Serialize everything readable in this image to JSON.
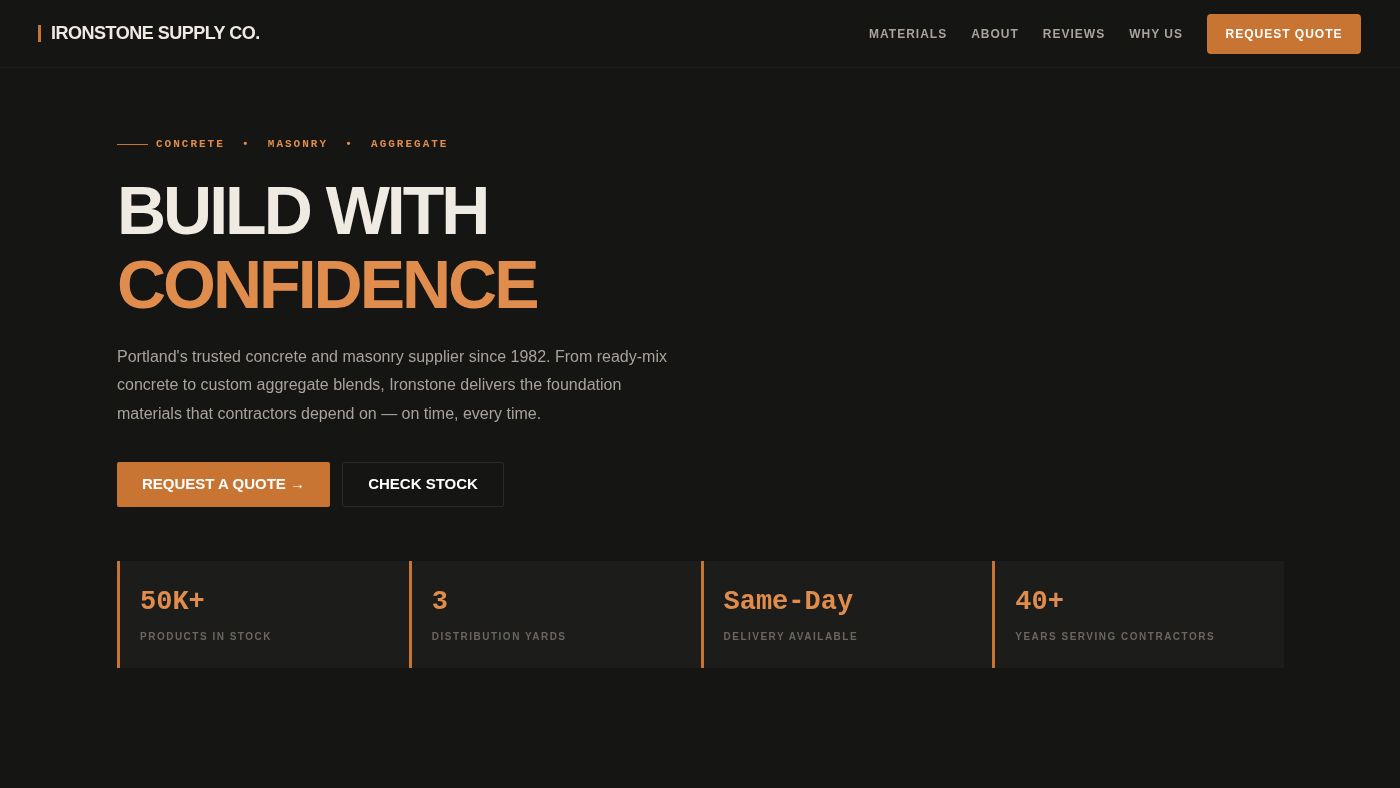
{
  "header": {
    "brand": "IRONSTONE SUPPLY CO.",
    "nav": [
      "MATERIALS",
      "ABOUT",
      "REVIEWS",
      "WHY US"
    ],
    "cta": "REQUEST QUOTE"
  },
  "hero": {
    "eyebrow": "CONCRETE • MASONRY • AGGREGATE",
    "headline_1": "BUILD WITH",
    "headline_2": "CONFIDENCE",
    "body": "Portland's trusted concrete and masonry supplier since 1982. From ready-mix concrete to custom aggregate blends, Ironstone delivers the foundation materials that contractors depend on — on time, every time.",
    "primary_button": "REQUEST A QUOTE →",
    "secondary_button": "CHECK STOCK"
  },
  "stats": [
    {
      "value": "50K+",
      "label": "PRODUCTS IN STOCK"
    },
    {
      "value": "3",
      "label": "DISTRIBUTION YARDS"
    },
    {
      "value": "Same-Day",
      "label": "DELIVERY AVAILABLE"
    },
    {
      "value": "40+",
      "label": "YEARS SERVING CONTRACTORS"
    }
  ]
}
